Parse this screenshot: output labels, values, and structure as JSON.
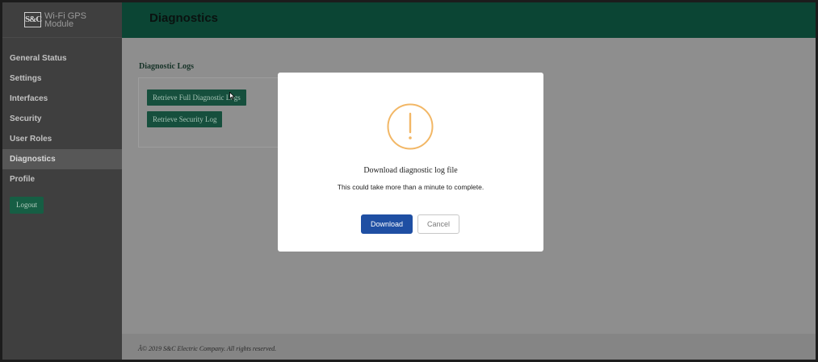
{
  "app": {
    "logo_mark": "S&C",
    "logo_line1": "Wi-Fi GPS",
    "logo_line2": "Module"
  },
  "sidebar": {
    "items": [
      {
        "label": "General Status"
      },
      {
        "label": "Settings"
      },
      {
        "label": "Interfaces"
      },
      {
        "label": "Security"
      },
      {
        "label": "User Roles"
      },
      {
        "label": "Diagnostics",
        "active": true
      },
      {
        "label": "Profile"
      }
    ],
    "logout_label": "Logout"
  },
  "header": {
    "title": "Diagnostics"
  },
  "main": {
    "section_title": "Diagnostic Logs",
    "buttons": {
      "full_logs": "Retrieve Full Diagnostic Logs",
      "security_log": "Retrieve Security Log"
    }
  },
  "footer": {
    "copyright": "Â© 2019 S&C Electric Company. All rights reserved."
  },
  "modal": {
    "icon": "exclamation-circle-icon",
    "title": "Download diagnostic log file",
    "message": "This could take more than a minute to complete.",
    "download_label": "Download",
    "cancel_label": "Cancel"
  },
  "colors": {
    "header_bg": "#0b4534",
    "sidebar_bg": "#3f3f3f",
    "accent_green": "#164f3d",
    "primary_blue": "#1f4fa3",
    "warning_orange": "#f2b766"
  }
}
